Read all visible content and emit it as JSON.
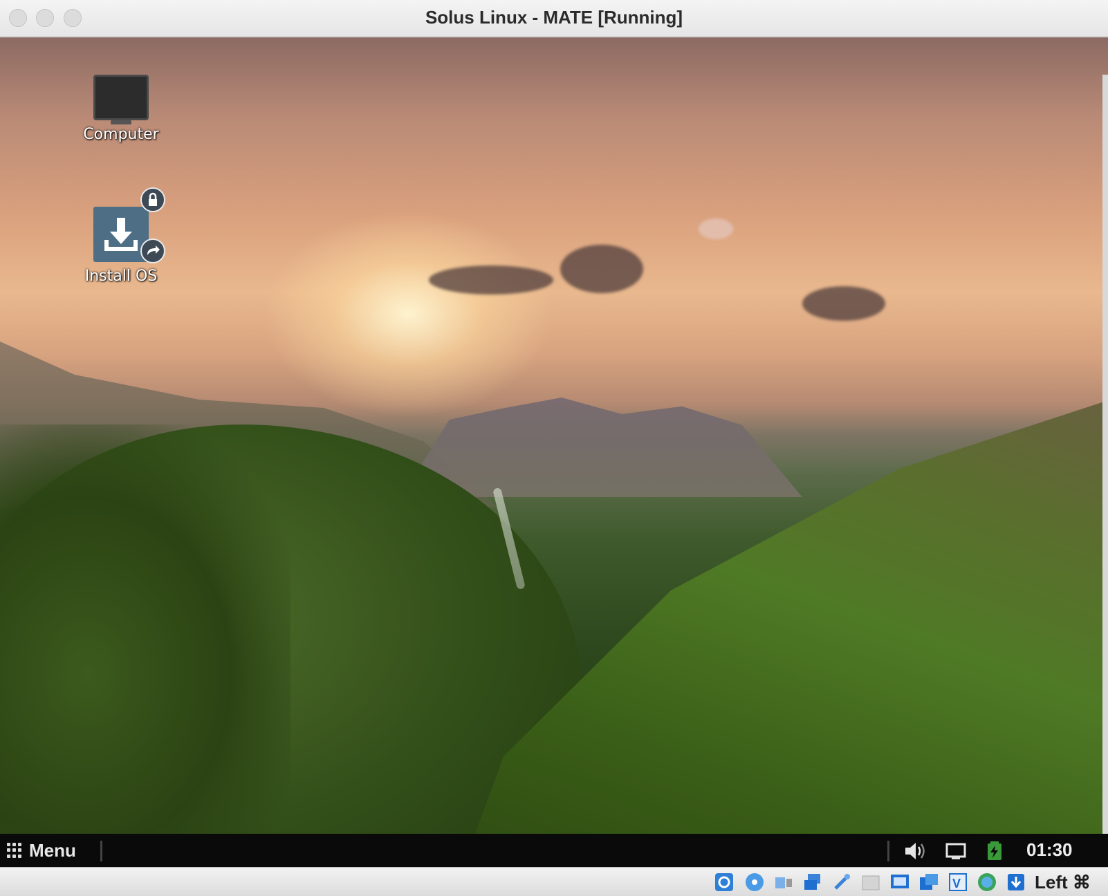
{
  "window": {
    "title": "Solus Linux - MATE [Running]"
  },
  "desktop": {
    "icons": [
      {
        "label": "Computer",
        "icon": "computer-monitor-icon"
      },
      {
        "label": "Install OS",
        "icon": "install-download-icon"
      }
    ]
  },
  "panel": {
    "menu_label": "Menu",
    "clock": "01:30",
    "tray_icons": [
      "volume-icon",
      "display-icon",
      "battery-icon"
    ]
  },
  "statusbar": {
    "host_key_label": "Left ⌘",
    "icons": [
      "hard-disk-icon",
      "optical-disk-icon",
      "audio-icon",
      "network-icon",
      "usb-icon",
      "shared-folders-icon",
      "display-icon",
      "video-capture-icon",
      "guest-additions-icon",
      "recording-icon",
      "mouse-integration-icon",
      "keyboard-capture-icon"
    ]
  },
  "colors": {
    "panel_bg": "#0a0a0a",
    "battery_green": "#3a9a3a",
    "vbox_blue": "#1e6fd0"
  }
}
